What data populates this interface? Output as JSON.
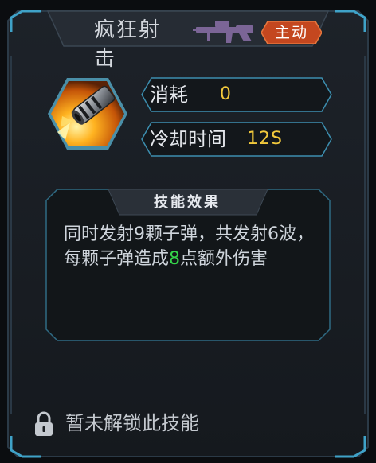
{
  "skill": {
    "name": "疯狂射击",
    "type_badge": "主动",
    "icon": "gun-muzzle-flash-icon",
    "weapon_icon": "machine-gun-icon"
  },
  "stats": {
    "cost_label": "消耗",
    "cost_value": "0",
    "cooldown_label": "冷却时间",
    "cooldown_value": "12S"
  },
  "effect": {
    "header": "技能效果",
    "text_part1": "同时发射9颗子弹，共发射6波，每颗子弹造成",
    "highlight_number": "8",
    "text_part2": "点额外伤害"
  },
  "lock": {
    "icon": "lock-icon",
    "text": "暂未解锁此技能"
  },
  "colors": {
    "frame_border": "#3a8fb0",
    "accent_value": "#f2c93c",
    "highlight": "#35d64a",
    "badge_bg": "#c4471f"
  }
}
